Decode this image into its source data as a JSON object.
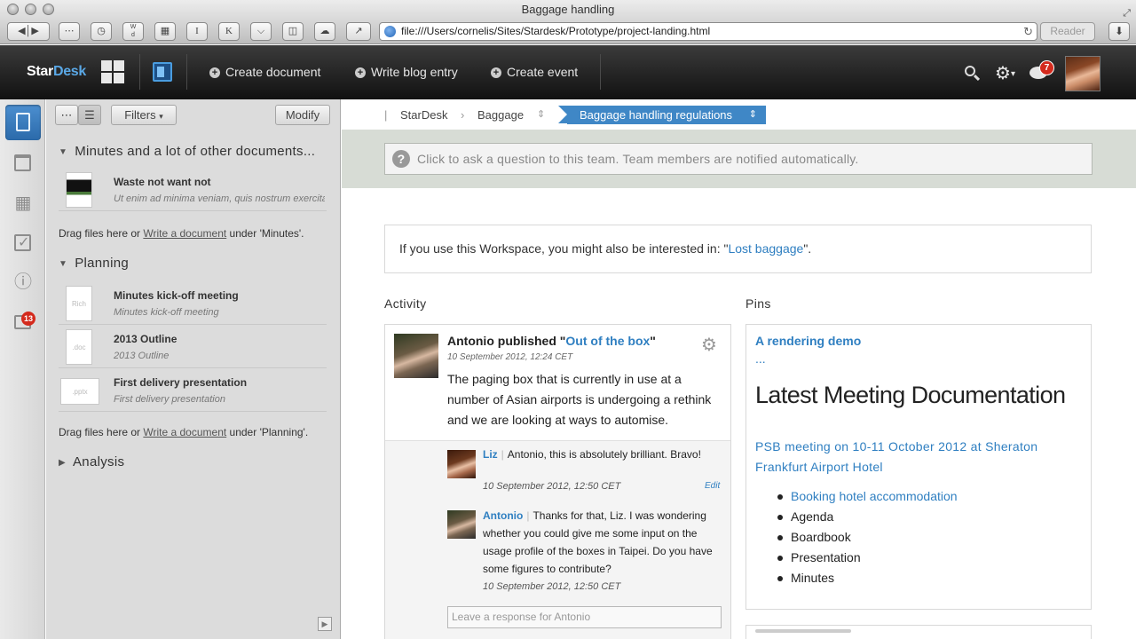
{
  "browser": {
    "window_title": "Baggage handling",
    "url": "file:///Users/cornelis/Sites/Stardesk/Prototype/project-landing.html",
    "reader_label": "Reader"
  },
  "app": {
    "logo_part1": "Star",
    "logo_part2": "Desk",
    "nav": {
      "create_document": "Create document",
      "write_blog": "Write blog entry",
      "create_event": "Create event"
    },
    "notification_count": "7"
  },
  "rail": {
    "badge_count": "13"
  },
  "sidebar": {
    "filters_label": "Filters",
    "modify_label": "Modify",
    "sections": [
      {
        "title": "Minutes and a lot of other documents...",
        "items": [
          {
            "title": "Waste not want not",
            "subtitle": "Ut enim ad minima veniam, quis nostrum exercitationem",
            "thumb": ""
          }
        ],
        "drag_prefix": "Drag files here or ",
        "drag_link": "Write a document",
        "drag_suffix": " under 'Minutes'."
      },
      {
        "title": "Planning",
        "items": [
          {
            "title": "Minutes kick-off meeting",
            "subtitle": "Minutes kick-off meeting",
            "thumb": "Rich"
          },
          {
            "title": "2013 Outline",
            "subtitle": "2013 Outline",
            "thumb": ".doc"
          },
          {
            "title": "First delivery presentation",
            "subtitle": "First delivery presentation",
            "thumb": ".pptx"
          }
        ],
        "drag_prefix": "Drag files here or ",
        "drag_link": "Write a document",
        "drag_suffix": " under 'Planning'."
      },
      {
        "title": "Analysis"
      }
    ]
  },
  "breadcrumb": {
    "items": [
      "StarDesk",
      "Baggage"
    ],
    "active": "Baggage handling regulations"
  },
  "ask": {
    "placeholder": "Click to ask a question to this team. Team members are notified automatically."
  },
  "interest": {
    "prefix": "If you use this Workspace, you might also be interested in: \"",
    "link": "Lost baggage",
    "suffix": "\"."
  },
  "activity": {
    "heading": "Activity",
    "post": {
      "author": "Antonio",
      "verb": " published \"",
      "link": "Out of the box",
      "close_quote": "\"",
      "date": "10 September 2012, 12:24 CET",
      "body": "The paging box that is currently in use at a number of Asian airports is undergoing a rethink and we are looking at ways to automise."
    },
    "comments": [
      {
        "author": "Liz",
        "text": "Antonio, this is absolutely brilliant. Bravo!",
        "date": "10 September 2012, 12:50 CET",
        "edit": "Edit"
      },
      {
        "author": "Antonio",
        "text": "Thanks for that, Liz. I was wondering whether you could give me some input on the usage profile of the boxes in Taipei. Do you have some figures to contribute?",
        "date": "10 September 2012, 12:50 CET"
      }
    ],
    "response_placeholder": "Leave a response for Antonio"
  },
  "pins": {
    "heading": "Pins",
    "link": "A rendering demo",
    "dots": "...",
    "big_heading": "Latest Meeting Documentation",
    "meeting": "PSB meeting on 10-11 October 2012 at  Sheraton Frankfurt Airport Hotel",
    "list": [
      "Booking hotel accommodation",
      "Agenda",
      "Boardbook",
      "Presentation",
      "Minutes"
    ]
  }
}
